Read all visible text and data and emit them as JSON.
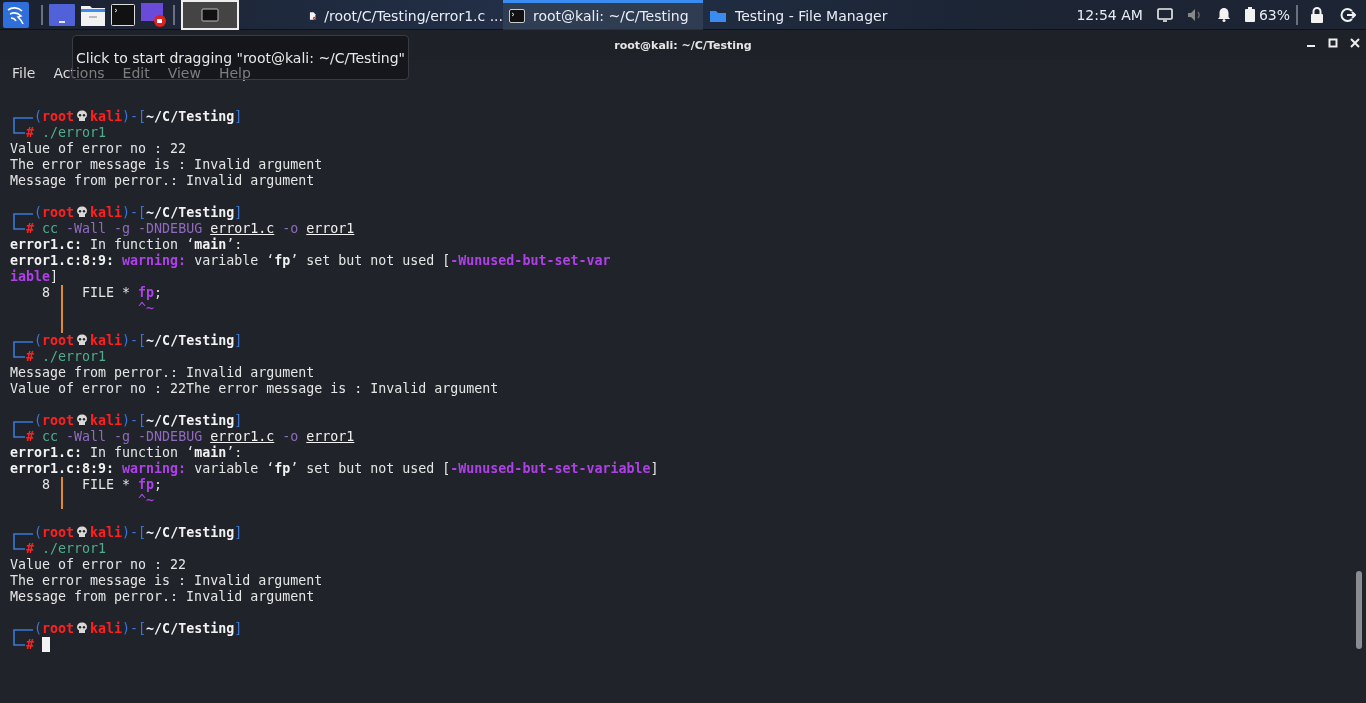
{
  "panel": {
    "tasks": [
      {
        "kind": "editor",
        "label": "/root/C/Testing/error1.c ...",
        "selected": false
      },
      {
        "kind": "terminal",
        "label": "root@kali: ~/C/Testing",
        "selected": true
      },
      {
        "kind": "folder",
        "label": "Testing - File Manager",
        "selected": false
      }
    ],
    "clock": "12:54 AM",
    "battery": "63%"
  },
  "tooltip": "Click to start dragging \"root@kali: ~/C/Testing\"",
  "window": {
    "title": "root@kali: ~/C/Testing"
  },
  "menu": [
    "File",
    "Actions",
    "Edit",
    "View",
    "Help"
  ],
  "terminal": {
    "lines": [
      {
        "kind": "prompt",
        "segments": [
          {
            "kind": "frame",
            "text": "("
          },
          {
            "kind": "user",
            "text": "root"
          },
          {
            "kind": "skull"
          },
          {
            "kind": "user",
            "text": "kali"
          },
          {
            "kind": "frame",
            "text": ")-["
          },
          {
            "kind": "path",
            "text": "~/C/Testing"
          },
          {
            "kind": "frame",
            "text": "]"
          }
        ]
      },
      {
        "kind": "command",
        "segments": [
          {
            "kind": "hash",
            "text": "#"
          },
          {
            "kind": "cmd",
            "text": " ./error1"
          }
        ]
      },
      {
        "kind": "output",
        "segments": [
          {
            "kind": "plain",
            "text": "Value of error no : 22"
          }
        ]
      },
      {
        "kind": "output",
        "segments": [
          {
            "kind": "plain",
            "text": "The error message is : Invalid argument"
          }
        ]
      },
      {
        "kind": "output",
        "segments": [
          {
            "kind": "plain",
            "text": "Message from perror.: Invalid argument"
          }
        ]
      },
      {
        "kind": "blank"
      },
      {
        "kind": "prompt",
        "segments": [
          {
            "kind": "frame",
            "text": "("
          },
          {
            "kind": "user",
            "text": "root"
          },
          {
            "kind": "skull"
          },
          {
            "kind": "user",
            "text": "kali"
          },
          {
            "kind": "frame",
            "text": ")-["
          },
          {
            "kind": "path",
            "text": "~/C/Testing"
          },
          {
            "kind": "frame",
            "text": "]"
          }
        ]
      },
      {
        "kind": "command",
        "segments": [
          {
            "kind": "hash",
            "text": "#"
          },
          {
            "kind": "cmd",
            "text": " cc"
          },
          {
            "kind": "option",
            "text": " -Wall -g -DNDEBUG "
          },
          {
            "kind": "file",
            "text": "error1.c"
          },
          {
            "kind": "option",
            "text": " -o "
          },
          {
            "kind": "file",
            "text": "error1"
          }
        ]
      },
      {
        "kind": "output",
        "segments": [
          {
            "kind": "bold",
            "text": "error1.c:"
          },
          {
            "kind": "plain",
            "text": " In function ‘"
          },
          {
            "kind": "bold",
            "text": "main"
          },
          {
            "kind": "plain",
            "text": "’:"
          }
        ]
      },
      {
        "kind": "output",
        "segments": [
          {
            "kind": "bold",
            "text": "error1.c:8:9:"
          },
          {
            "kind": "warn",
            "text": " warning:"
          },
          {
            "kind": "plain",
            "text": " variable ‘"
          },
          {
            "kind": "bold",
            "text": "fp"
          },
          {
            "kind": "plain",
            "text": "’ set but not used ["
          },
          {
            "kind": "warn",
            "text": "-Wunused-but-set-var"
          }
        ]
      },
      {
        "kind": "output",
        "segments": [
          {
            "kind": "warn",
            "text": "iable"
          },
          {
            "kind": "plain",
            "text": "]"
          }
        ]
      },
      {
        "kind": "source",
        "lineno": "8",
        "segments": [
          {
            "kind": "plain",
            "text": "FILE * "
          },
          {
            "kind": "warn",
            "text": "fp"
          },
          {
            "kind": "plain",
            "text": ";"
          }
        ]
      },
      {
        "kind": "marker",
        "caret": "^~"
      },
      {
        "kind": "gutter"
      },
      {
        "kind": "prompt",
        "segments": [
          {
            "kind": "frame",
            "text": "("
          },
          {
            "kind": "user",
            "text": "root"
          },
          {
            "kind": "skull"
          },
          {
            "kind": "user",
            "text": "kali"
          },
          {
            "kind": "frame",
            "text": ")-["
          },
          {
            "kind": "path",
            "text": "~/C/Testing"
          },
          {
            "kind": "frame",
            "text": "]"
          }
        ]
      },
      {
        "kind": "command",
        "segments": [
          {
            "kind": "hash",
            "text": "#"
          },
          {
            "kind": "cmd",
            "text": " ./error1"
          }
        ]
      },
      {
        "kind": "output",
        "segments": [
          {
            "kind": "plain",
            "text": "Message from perror.: Invalid argument"
          }
        ]
      },
      {
        "kind": "output",
        "segments": [
          {
            "kind": "plain",
            "text": "Value of error no : 22The error message is : Invalid argument"
          }
        ]
      },
      {
        "kind": "blank"
      },
      {
        "kind": "prompt",
        "segments": [
          {
            "kind": "frame",
            "text": "("
          },
          {
            "kind": "user",
            "text": "root"
          },
          {
            "kind": "skull"
          },
          {
            "kind": "user",
            "text": "kali"
          },
          {
            "kind": "frame",
            "text": ")-["
          },
          {
            "kind": "path",
            "text": "~/C/Testing"
          },
          {
            "kind": "frame",
            "text": "]"
          }
        ]
      },
      {
        "kind": "command",
        "segments": [
          {
            "kind": "hash",
            "text": "#"
          },
          {
            "kind": "cmd",
            "text": " cc"
          },
          {
            "kind": "option",
            "text": " -Wall -g -DNDEBUG "
          },
          {
            "kind": "file",
            "text": "error1.c"
          },
          {
            "kind": "option",
            "text": " -o "
          },
          {
            "kind": "file",
            "text": "error1"
          }
        ]
      },
      {
        "kind": "output",
        "segments": [
          {
            "kind": "bold",
            "text": "error1.c:"
          },
          {
            "kind": "plain",
            "text": " In function ‘"
          },
          {
            "kind": "bold",
            "text": "main"
          },
          {
            "kind": "plain",
            "text": "’:"
          }
        ]
      },
      {
        "kind": "output",
        "segments": [
          {
            "kind": "bold",
            "text": "error1.c:8:9:"
          },
          {
            "kind": "warn",
            "text": " warning:"
          },
          {
            "kind": "plain",
            "text": " variable ‘"
          },
          {
            "kind": "bold",
            "text": "fp"
          },
          {
            "kind": "plain",
            "text": "’ set but not used ["
          },
          {
            "kind": "warn",
            "text": "-Wunused-but-set-variable"
          },
          {
            "kind": "plain",
            "text": "]"
          }
        ]
      },
      {
        "kind": "source",
        "lineno": "8",
        "segments": [
          {
            "kind": "plain",
            "text": "FILE * "
          },
          {
            "kind": "warn",
            "text": "fp"
          },
          {
            "kind": "plain",
            "text": ";"
          }
        ]
      },
      {
        "kind": "marker",
        "caret": "^~"
      },
      {
        "kind": "blank"
      },
      {
        "kind": "prompt",
        "segments": [
          {
            "kind": "frame",
            "text": "("
          },
          {
            "kind": "user",
            "text": "root"
          },
          {
            "kind": "skull"
          },
          {
            "kind": "user",
            "text": "kali"
          },
          {
            "kind": "frame",
            "text": ")-["
          },
          {
            "kind": "path",
            "text": "~/C/Testing"
          },
          {
            "kind": "frame",
            "text": "]"
          }
        ]
      },
      {
        "kind": "command",
        "segments": [
          {
            "kind": "hash",
            "text": "#"
          },
          {
            "kind": "cmd",
            "text": " ./error1"
          }
        ]
      },
      {
        "kind": "output",
        "segments": [
          {
            "kind": "plain",
            "text": "Value of error no : 22"
          }
        ]
      },
      {
        "kind": "output",
        "segments": [
          {
            "kind": "plain",
            "text": "The error message is : Invalid argument"
          }
        ]
      },
      {
        "kind": "output",
        "segments": [
          {
            "kind": "plain",
            "text": "Message from perror.: Invalid argument"
          }
        ]
      },
      {
        "kind": "blank"
      },
      {
        "kind": "prompt",
        "segments": [
          {
            "kind": "frame",
            "text": "("
          },
          {
            "kind": "user",
            "text": "root"
          },
          {
            "kind": "skull"
          },
          {
            "kind": "user",
            "text": "kali"
          },
          {
            "kind": "frame",
            "text": ")-["
          },
          {
            "kind": "path",
            "text": "~/C/Testing"
          },
          {
            "kind": "frame",
            "text": "]"
          }
        ]
      },
      {
        "kind": "command",
        "cursor": true,
        "segments": [
          {
            "kind": "hash",
            "text": "#"
          }
        ]
      }
    ]
  }
}
